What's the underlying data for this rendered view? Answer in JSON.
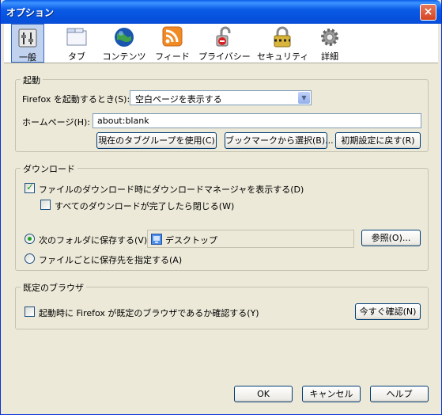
{
  "window": {
    "title": "オプション",
    "close_glyph": "×"
  },
  "toolbar": [
    {
      "label": "一般",
      "icon": "general-icon"
    },
    {
      "label": "タブ",
      "icon": "tabs-icon"
    },
    {
      "label": "コンテンツ",
      "icon": "content-icon"
    },
    {
      "label": "フィード",
      "icon": "feeds-icon"
    },
    {
      "label": "プライバシー",
      "icon": "privacy-icon"
    },
    {
      "label": "セキュリティ",
      "icon": "security-icon"
    },
    {
      "label": "詳細",
      "icon": "advanced-icon"
    }
  ],
  "startup": {
    "legend": "起動",
    "when_label": "Firefox を起動するとき(S):",
    "when_value": "空白ページを表示する",
    "homepage_label": "ホームページ(H):",
    "homepage_value": "about:blank",
    "btn_current": "現在のタブグループを使用(C)",
    "btn_bookmark": "ブックマークから選択(B)...",
    "btn_restore": "初期設定に戻す(R)"
  },
  "downloads": {
    "legend": "ダウンロード",
    "show_manager": "ファイルのダウンロード時にダウンロードマネージャを表示する(D)",
    "close_when_done": "すべてのダウンロードが完了したら閉じる(W)",
    "save_to": "次のフォルダに保存する(V)",
    "folder": "デスクトップ",
    "browse": "参照(O)...",
    "ask": "ファイルごとに保存先を指定する(A)"
  },
  "default_browser": {
    "legend": "既定のブラウザ",
    "check_label": "起動時に Firefox が既定のブラウザであるか確認する(Y)",
    "check_now": "今すぐ確認(N)"
  },
  "footer": {
    "ok": "OK",
    "cancel": "キャンセル",
    "help": "ヘルプ"
  }
}
